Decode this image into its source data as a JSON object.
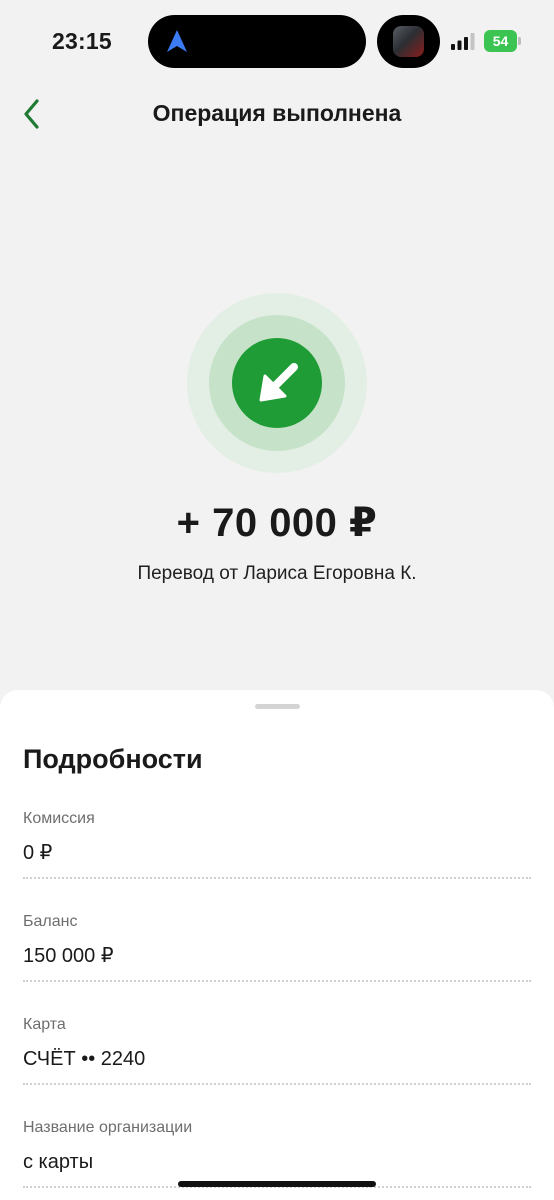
{
  "status_bar": {
    "time": "23:15",
    "battery": "54",
    "icons": [
      "location-arrow-icon",
      "app-thumbnail-icon",
      "signal-icon",
      "battery-icon"
    ]
  },
  "header": {
    "back_icon": "chevron-left-icon",
    "title": "Операция выполнена"
  },
  "operation": {
    "icon": "incoming-arrow-icon",
    "amount": "+ 70 000 ₽",
    "description": "Перевод от Лариса Егоровна К."
  },
  "details": {
    "title": "Подробности",
    "items": [
      {
        "label": "Комиссия",
        "value": "0 ₽"
      },
      {
        "label": "Баланс",
        "value": "150 000 ₽"
      },
      {
        "label": "Карта",
        "value": "СЧЁТ •• 2240"
      },
      {
        "label": "Название организации",
        "value": "с карты"
      }
    ]
  },
  "colors": {
    "accent": "#1f9c36",
    "background": "#f2f2f2",
    "battery": "#3cc453"
  }
}
